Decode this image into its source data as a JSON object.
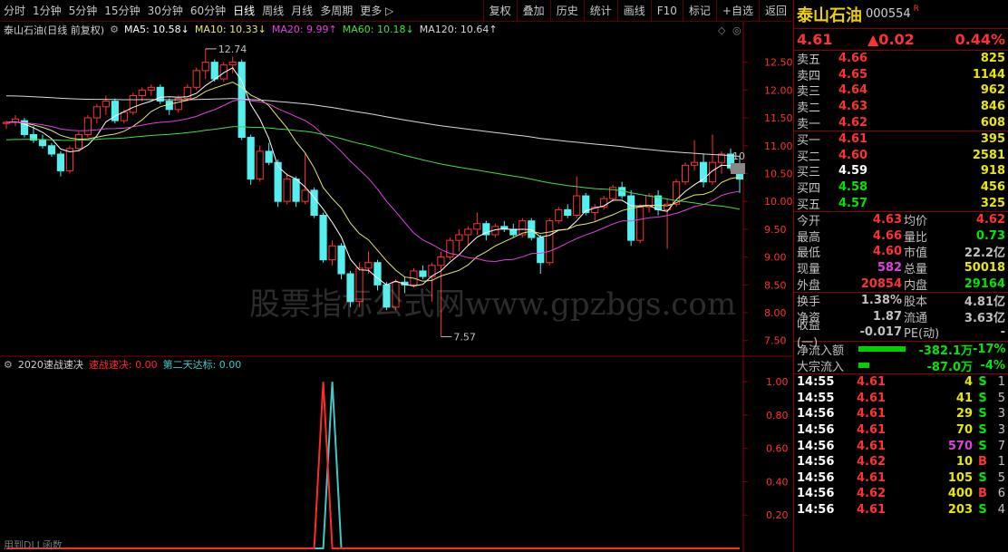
{
  "toolbar": {
    "left": [
      "分时",
      "1分钟",
      "5分钟",
      "15分钟",
      "30分钟",
      "60分钟",
      "日线",
      "周线",
      "月线",
      "多周期",
      "更多 ▷"
    ],
    "right": [
      "复权",
      "叠加",
      "历史",
      "统计",
      "画线",
      "F10",
      "标记",
      "+自选",
      "返回"
    ]
  },
  "main_header": {
    "title": "泰山石油(日线 前复权)",
    "ma5": "MA5: 10.58↓",
    "ma10": "MA10: 10.33↓",
    "ma20": "MA20: 9.99↑",
    "ma60": "MA60: 10.18↓",
    "ma120": "MA120: 10.64↑"
  },
  "colors": {
    "up": "#ff3232",
    "down": "#54f0f0",
    "ma5": "#ffffff",
    "ma10": "#e8e870",
    "ma20": "#e040e0",
    "ma60": "#40e040",
    "ma120": "#d8d8d8",
    "signal1": "#ff2a2a",
    "signal2": "#40c8c8"
  },
  "watermark": "股票指标公式网www.gpzbgs.com",
  "chart_data": [
    {
      "type": "candlestick",
      "title": "泰山石油(日线 前复权)",
      "y_ticks": [
        "12.50",
        "12.00",
        "11.50",
        "11.00",
        "10.50",
        "10.00",
        "9.50",
        "9.00",
        "8.50",
        "8.00",
        "7.50"
      ],
      "ylim": [
        7.3,
        12.95
      ],
      "annotations": {
        "high": "12.74",
        "low": "7.57",
        "right_marker": "10"
      },
      "candles": [
        [
          11.4,
          11.45,
          11.3,
          11.42
        ],
        [
          11.42,
          11.55,
          11.35,
          11.48
        ],
        [
          11.45,
          11.5,
          11.15,
          11.2
        ],
        [
          11.2,
          11.35,
          11.05,
          11.1
        ],
        [
          11.1,
          11.2,
          10.95,
          11.0
        ],
        [
          11.0,
          11.05,
          10.8,
          10.85
        ],
        [
          10.85,
          10.9,
          10.45,
          10.55
        ],
        [
          10.55,
          11.0,
          10.5,
          10.95
        ],
        [
          10.95,
          11.25,
          10.9,
          11.2
        ],
        [
          11.2,
          11.55,
          11.15,
          11.5
        ],
        [
          11.5,
          11.75,
          11.4,
          11.7
        ],
        [
          11.7,
          11.9,
          11.55,
          11.8
        ],
        [
          11.8,
          11.85,
          11.4,
          11.45
        ],
        [
          11.45,
          11.65,
          11.4,
          11.6
        ],
        [
          11.6,
          11.95,
          11.55,
          11.9
        ],
        [
          11.9,
          12.05,
          11.8,
          12.0
        ],
        [
          12.0,
          12.1,
          11.9,
          12.05
        ],
        [
          12.05,
          12.1,
          11.75,
          11.8
        ],
        [
          11.8,
          11.85,
          11.55,
          11.65
        ],
        [
          11.65,
          11.9,
          11.6,
          11.85
        ],
        [
          11.85,
          12.1,
          11.8,
          12.05
        ],
        [
          12.05,
          12.4,
          12.0,
          12.35
        ],
        [
          12.35,
          12.74,
          12.2,
          12.5
        ],
        [
          12.5,
          12.55,
          12.15,
          12.2
        ],
        [
          12.2,
          12.5,
          12.15,
          12.45
        ],
        [
          12.45,
          12.6,
          12.3,
          12.5
        ],
        [
          12.5,
          12.55,
          11.1,
          11.15
        ],
        [
          11.15,
          11.2,
          10.3,
          10.4
        ],
        [
          10.4,
          11.0,
          10.35,
          10.9
        ],
        [
          10.9,
          11.05,
          10.65,
          10.7
        ],
        [
          10.7,
          10.75,
          9.9,
          10.0
        ],
        [
          10.0,
          10.5,
          9.95,
          10.4
        ],
        [
          10.4,
          10.45,
          9.9,
          10.0
        ],
        [
          10.0,
          10.85,
          9.95,
          10.2
        ],
        [
          10.2,
          10.25,
          9.7,
          9.75
        ],
        [
          9.75,
          9.8,
          8.9,
          8.95
        ],
        [
          8.95,
          9.3,
          8.85,
          9.2
        ],
        [
          9.2,
          9.25,
          8.6,
          8.7
        ],
        [
          8.7,
          8.75,
          8.1,
          8.2
        ],
        [
          8.2,
          8.9,
          8.1,
          8.8
        ],
        [
          8.8,
          9.1,
          8.7,
          8.9
        ],
        [
          8.9,
          8.95,
          8.4,
          8.5
        ],
        [
          8.5,
          8.55,
          8.05,
          8.1
        ],
        [
          8.1,
          8.6,
          8.05,
          8.55
        ],
        [
          8.55,
          8.65,
          8.35,
          8.5
        ],
        [
          8.5,
          8.8,
          8.45,
          8.75
        ],
        [
          8.75,
          8.85,
          8.6,
          8.65
        ],
        [
          8.65,
          8.9,
          8.2,
          8.85
        ],
        [
          8.85,
          9.1,
          7.57,
          9.0
        ],
        [
          9.0,
          9.35,
          8.95,
          9.3
        ],
        [
          9.3,
          9.5,
          9.1,
          9.4
        ],
        [
          9.4,
          9.55,
          9.2,
          9.5
        ],
        [
          9.5,
          9.8,
          9.4,
          9.6
        ],
        [
          9.6,
          9.65,
          9.3,
          9.4
        ],
        [
          9.4,
          9.6,
          9.35,
          9.55
        ],
        [
          9.55,
          9.65,
          9.45,
          9.5
        ],
        [
          9.5,
          9.6,
          9.35,
          9.4
        ],
        [
          9.4,
          9.7,
          9.35,
          9.65
        ],
        [
          9.65,
          9.7,
          9.3,
          9.35
        ],
        [
          9.35,
          9.4,
          8.7,
          8.9
        ],
        [
          8.9,
          9.7,
          8.85,
          9.65
        ],
        [
          9.65,
          9.9,
          9.6,
          9.85
        ],
        [
          9.85,
          9.95,
          9.7,
          9.75
        ],
        [
          9.75,
          10.45,
          9.7,
          10.1
        ],
        [
          10.1,
          10.15,
          9.75,
          9.8
        ],
        [
          9.8,
          9.95,
          9.65,
          9.9
        ],
        [
          9.9,
          10.1,
          9.85,
          10.05
        ],
        [
          10.05,
          10.3,
          10.0,
          10.25
        ],
        [
          10.25,
          10.35,
          10.05,
          10.1
        ],
        [
          10.1,
          10.2,
          9.2,
          9.3
        ],
        [
          9.3,
          9.95,
          9.25,
          9.9
        ],
        [
          9.9,
          10.15,
          9.8,
          10.1
        ],
        [
          10.1,
          10.2,
          9.75,
          9.85
        ],
        [
          9.85,
          10.05,
          9.15,
          9.95
        ],
        [
          9.95,
          10.4,
          9.9,
          10.35
        ],
        [
          10.35,
          10.7,
          10.3,
          10.65
        ],
        [
          10.65,
          11.1,
          10.55,
          10.7
        ],
        [
          10.7,
          10.85,
          10.25,
          10.35
        ],
        [
          10.35,
          11.2,
          10.3,
          10.7
        ],
        [
          10.7,
          10.9,
          10.5,
          10.85
        ],
        [
          10.85,
          10.95,
          10.55,
          10.6
        ],
        [
          10.6,
          10.8,
          10.15,
          10.4
        ]
      ]
    },
    {
      "type": "line",
      "title": "2020速战速决",
      "series": [
        {
          "name": "速战速决",
          "value": "0.00"
        },
        {
          "name": "第二天达标",
          "value": "0.00"
        }
      ],
      "y_ticks": [
        "1.00",
        "0.80",
        "0.60",
        "0.40",
        "0.20"
      ],
      "ylim": [
        0,
        1.05
      ],
      "spike_1_index": 35,
      "spike_2_index": 36
    }
  ],
  "indicator_header": {
    "title": "2020速战速决",
    "s1_label": "速战速决: 0.00",
    "s2_label": "第二天达标: 0.00"
  },
  "footer_note": "用到DLL函数",
  "quote": {
    "name": "泰山石油",
    "code": "000554",
    "r_badge": "R",
    "price": "4.61",
    "change": "▲0.02",
    "change_pct": "0.44%",
    "asks": [
      {
        "label": "卖五",
        "price": "4.66",
        "vol": "825"
      },
      {
        "label": "卖四",
        "price": "4.65",
        "vol": "1144"
      },
      {
        "label": "卖三",
        "price": "4.64",
        "vol": "962"
      },
      {
        "label": "卖二",
        "price": "4.63",
        "vol": "846"
      },
      {
        "label": "卖一",
        "price": "4.62",
        "vol": "608"
      }
    ],
    "bids": [
      {
        "label": "买一",
        "price": "4.61",
        "vol": "395",
        "color": "red"
      },
      {
        "label": "买二",
        "price": "4.60",
        "vol": "2581",
        "color": "red"
      },
      {
        "label": "买三",
        "price": "4.59",
        "vol": "918",
        "color": "wht"
      },
      {
        "label": "买四",
        "price": "4.58",
        "vol": "456",
        "color": "green"
      },
      {
        "label": "买五",
        "price": "4.57",
        "vol": "325",
        "color": "green"
      }
    ],
    "stats1": [
      {
        "l1": "今开",
        "v1": "4.63",
        "c1": "red",
        "l2": "均价",
        "v2": "4.62",
        "c2": "red"
      },
      {
        "l1": "最高",
        "v1": "4.66",
        "c1": "red",
        "l2": "量比",
        "v2": "0.73",
        "c2": "green"
      },
      {
        "l1": "最低",
        "v1": "4.60",
        "c1": "red",
        "l2": "市值",
        "v2": "22.2亿",
        "c2": "gry"
      },
      {
        "l1": "现量",
        "v1": "582",
        "c1": "mag",
        "l2": "总量",
        "v2": "50018",
        "c2": "yel"
      },
      {
        "l1": "外盘",
        "v1": "20854",
        "c1": "red",
        "l2": "内盘",
        "v2": "29164",
        "c2": "green"
      }
    ],
    "stats2": [
      {
        "l1": "换手",
        "v1": "1.38%",
        "c1": "gry",
        "l2": "股本",
        "v2": "4.81亿",
        "c2": "gry"
      },
      {
        "l1": "净资",
        "v1": "1.87",
        "c1": "gry",
        "l2": "流通",
        "v2": "3.63亿",
        "c2": "gry"
      },
      {
        "l1": "收益(一)",
        "v1": "-0.017",
        "c1": "gry",
        "l2": "PE(动)",
        "v2": "-",
        "c2": "gry"
      }
    ],
    "flows": [
      {
        "label": "净流入额",
        "bar": 0.93,
        "val": "-382.1万",
        "pct": "-17%"
      },
      {
        "label": "大宗流入",
        "bar": 0.22,
        "val": "-87.0万",
        "pct": "-4%"
      }
    ],
    "ticks": [
      {
        "time": "14:55",
        "price": "4.61",
        "vol": "4",
        "side": "S",
        "n": "1",
        "vc": "yel",
        "sc": "green"
      },
      {
        "time": "14:55",
        "price": "4.61",
        "vol": "41",
        "side": "S",
        "n": "5",
        "vc": "yel",
        "sc": "green"
      },
      {
        "time": "14:56",
        "price": "4.61",
        "vol": "29",
        "side": "S",
        "n": "3",
        "vc": "yel",
        "sc": "green"
      },
      {
        "time": "14:56",
        "price": "4.61",
        "vol": "70",
        "side": "S",
        "n": "3",
        "vc": "yel",
        "sc": "green"
      },
      {
        "time": "14:56",
        "price": "4.61",
        "vol": "570",
        "side": "S",
        "n": "7",
        "vc": "mag",
        "sc": "green"
      },
      {
        "time": "14:56",
        "price": "4.62",
        "vol": "10",
        "side": "B",
        "n": "1",
        "vc": "yel",
        "sc": "red"
      },
      {
        "time": "14:56",
        "price": "4.61",
        "vol": "105",
        "side": "S",
        "n": "5",
        "vc": "yel",
        "sc": "green"
      },
      {
        "time": "14:56",
        "price": "4.62",
        "vol": "400",
        "side": "B",
        "n": "6",
        "vc": "yel",
        "sc": "red"
      },
      {
        "time": "14:56",
        "price": "4.61",
        "vol": "203",
        "side": "S",
        "n": "4",
        "vc": "yel",
        "sc": "green"
      }
    ]
  }
}
